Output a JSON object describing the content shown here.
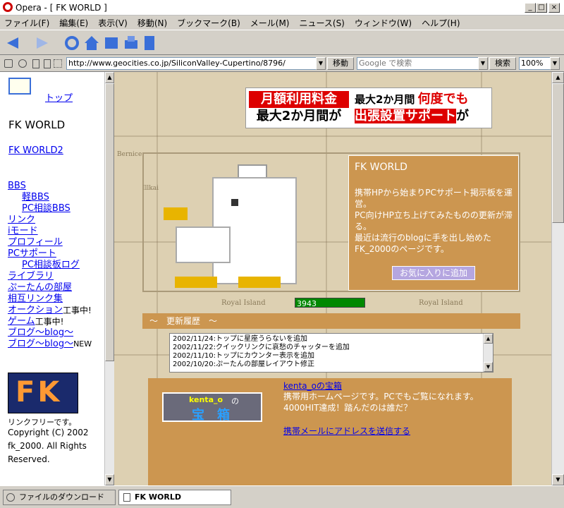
{
  "window": {
    "title": "Opera - [ FK WORLD ]"
  },
  "menu": [
    "ファイル(F)",
    "編集(E)",
    "表示(V)",
    "移動(N)",
    "ブックマーク(B)",
    "メール(M)",
    "ニュース(S)",
    "ウィンドウ(W)",
    "ヘルプ(H)"
  ],
  "address": {
    "url": "http://www.geocities.co.jp/SiliconValley-Cupertino/8796/",
    "go_label": "移動",
    "search_placeholder": "Google で検索",
    "search_label": "検索",
    "zoom": "100%"
  },
  "sidebar": {
    "top_link": "トップ",
    "site_title": "FK WORLD",
    "fk2_link": "FK WORLD2",
    "links": [
      {
        "label": "BBS",
        "indent": false,
        "note": ""
      },
      {
        "label": "軽BBS",
        "indent": true,
        "note": ""
      },
      {
        "label": "PC相談BBS",
        "indent": true,
        "note": ""
      },
      {
        "label": "リンク",
        "indent": false,
        "note": ""
      },
      {
        "label": "iモード",
        "indent": false,
        "note": ""
      },
      {
        "label": "プロフィール",
        "indent": false,
        "note": ""
      },
      {
        "label": "PCサポート",
        "indent": false,
        "note": ""
      },
      {
        "label": "PC相談板ログ",
        "indent": true,
        "note": ""
      },
      {
        "label": "ライブラリ",
        "indent": false,
        "note": ""
      },
      {
        "label": "ぷーたんの部屋",
        "indent": false,
        "note": ""
      },
      {
        "label": "相互リンク集",
        "indent": false,
        "note": ""
      },
      {
        "label": "オークション",
        "indent": false,
        "note": "工事中!"
      },
      {
        "label": "ゲーム",
        "indent": false,
        "note": "工事中!"
      },
      {
        "label": "ブログ～blog～",
        "indent": false,
        "note": ""
      },
      {
        "label": "ブログ～blog～",
        "indent": false,
        "note": "NEW"
      }
    ],
    "logo_text": "FK",
    "link_free": "リンクフリーです。",
    "copyright": "Copyright (C) 2002 fk_2000. All Rights Reserved."
  },
  "banner": {
    "line1a": "月額利用料金",
    "line1b": "最大2か月間が",
    "line2a": "最大2か月間",
    "line2b": "何度でも",
    "line2c": "出張設置サポート",
    "line2d": "が"
  },
  "profile": {
    "title": "FK WORLD",
    "text": "携帯HPから始まりPCサポート掲示板を運営。\nPC向けHP立ち上げてみたものの更新が滞る。\n最近は流行のblogに手を出し始めたFK_2000のページです。",
    "fav_button": "お気に入りに追加"
  },
  "map_labels": {
    "royal1": "Royal Island",
    "royal2": "Royal Island",
    "bernice": "Bernice",
    "illkai": "Illkai"
  },
  "counter": "3943",
  "history": {
    "heading": "～　更新履歴　～",
    "items": [
      "2002/11/24:トップに星座うらないを追加",
      "2002/11/22:クイックリンクに哀愁のチャッターを追加",
      "2002/11/10:トップにカウンター表示を追加",
      "2002/10/20:ぷーたんの部屋レイアウト修正"
    ]
  },
  "kenta": {
    "banner_name": "kenta_o",
    "banner_no": "の",
    "banner_title": "宝　箱",
    "link": "kenta_oの宝箱",
    "desc": "携帯用ホームページです。PCでもご覧になれます。",
    "hit": "4000HIT達成！踏んだのは誰だ？",
    "mail_link": "携帯メールにアドレスを送信する"
  },
  "status": {
    "download": "ファイルのダウンロード",
    "tab": "FK WORLD"
  },
  "colors": {
    "tan": "#cc9650",
    "map": "#ddd0b2",
    "link": "#0000ee",
    "counter": "#008000"
  }
}
